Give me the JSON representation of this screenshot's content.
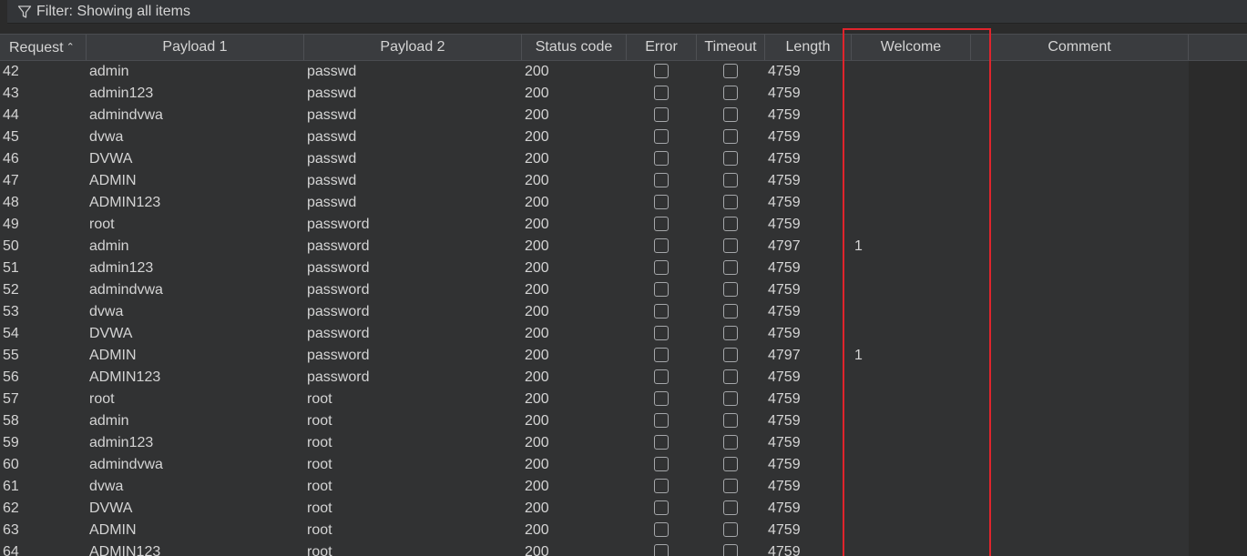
{
  "filter": {
    "label": "Filter: Showing all items"
  },
  "columns": {
    "request": "Request",
    "payload1": "Payload 1",
    "payload2": "Payload 2",
    "status": "Status code",
    "error": "Error",
    "timeout": "Timeout",
    "length": "Length",
    "welcome": "Welcome",
    "comment": "Comment"
  },
  "rows": [
    {
      "request": "42",
      "payload1": "admin",
      "payload2": "passwd",
      "status": "200",
      "length": "4759",
      "welcome": ""
    },
    {
      "request": "43",
      "payload1": "admin123",
      "payload2": "passwd",
      "status": "200",
      "length": "4759",
      "welcome": ""
    },
    {
      "request": "44",
      "payload1": "admindvwa",
      "payload2": "passwd",
      "status": "200",
      "length": "4759",
      "welcome": ""
    },
    {
      "request": "45",
      "payload1": "dvwa",
      "payload2": "passwd",
      "status": "200",
      "length": "4759",
      "welcome": ""
    },
    {
      "request": "46",
      "payload1": "DVWA",
      "payload2": "passwd",
      "status": "200",
      "length": "4759",
      "welcome": ""
    },
    {
      "request": "47",
      "payload1": "ADMIN",
      "payload2": "passwd",
      "status": "200",
      "length": "4759",
      "welcome": ""
    },
    {
      "request": "48",
      "payload1": "ADMIN123",
      "payload2": "passwd",
      "status": "200",
      "length": "4759",
      "welcome": ""
    },
    {
      "request": "49",
      "payload1": "root",
      "payload2": "password",
      "status": "200",
      "length": "4759",
      "welcome": ""
    },
    {
      "request": "50",
      "payload1": "admin",
      "payload2": "password",
      "status": "200",
      "length": "4797",
      "welcome": "1"
    },
    {
      "request": "51",
      "payload1": "admin123",
      "payload2": "password",
      "status": "200",
      "length": "4759",
      "welcome": ""
    },
    {
      "request": "52",
      "payload1": "admindvwa",
      "payload2": "password",
      "status": "200",
      "length": "4759",
      "welcome": ""
    },
    {
      "request": "53",
      "payload1": "dvwa",
      "payload2": "password",
      "status": "200",
      "length": "4759",
      "welcome": ""
    },
    {
      "request": "54",
      "payload1": "DVWA",
      "payload2": "password",
      "status": "200",
      "length": "4759",
      "welcome": ""
    },
    {
      "request": "55",
      "payload1": "ADMIN",
      "payload2": "password",
      "status": "200",
      "length": "4797",
      "welcome": "1"
    },
    {
      "request": "56",
      "payload1": "ADMIN123",
      "payload2": "password",
      "status": "200",
      "length": "4759",
      "welcome": ""
    },
    {
      "request": "57",
      "payload1": "root",
      "payload2": "root",
      "status": "200",
      "length": "4759",
      "welcome": ""
    },
    {
      "request": "58",
      "payload1": "admin",
      "payload2": "root",
      "status": "200",
      "length": "4759",
      "welcome": ""
    },
    {
      "request": "59",
      "payload1": "admin123",
      "payload2": "root",
      "status": "200",
      "length": "4759",
      "welcome": ""
    },
    {
      "request": "60",
      "payload1": "admindvwa",
      "payload2": "root",
      "status": "200",
      "length": "4759",
      "welcome": ""
    },
    {
      "request": "61",
      "payload1": "dvwa",
      "payload2": "root",
      "status": "200",
      "length": "4759",
      "welcome": ""
    },
    {
      "request": "62",
      "payload1": "DVWA",
      "payload2": "root",
      "status": "200",
      "length": "4759",
      "welcome": ""
    },
    {
      "request": "63",
      "payload1": "ADMIN",
      "payload2": "root",
      "status": "200",
      "length": "4759",
      "welcome": ""
    },
    {
      "request": "64",
      "payload1": "ADMIN123",
      "payload2": "root",
      "status": "200",
      "length": "4759",
      "welcome": ""
    }
  ],
  "colors": {
    "background": "#2b2b2b",
    "table_bg": "#313233",
    "header_bg": "#3a3c3f",
    "text": "#d4d4d4",
    "highlight_border": "#e0242c"
  }
}
